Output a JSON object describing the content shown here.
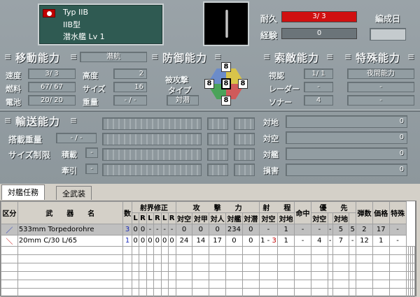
{
  "unit": {
    "type": "Typ IIB",
    "class": "IIB型",
    "name": "潜水艦 Lv 1",
    "flag_icon": "swastika-flag-icon"
  },
  "stats_top": {
    "durability_label": "耐久",
    "durability": "3/ 3",
    "durability_fill": 1.0,
    "exp_label": "経験",
    "exp": "0",
    "fleet_label": "編成日",
    "fleet_value": ""
  },
  "movement": {
    "title": "移動能力",
    "mode": "潜航",
    "speed_label": "速度",
    "speed": "3/ 3",
    "altitude_label": "高度",
    "altitude": "2",
    "fuel_label": "燃料",
    "fuel": "67/ 67",
    "size_label": "サイズ",
    "size": "16",
    "battery_label": "電池",
    "battery": "20/ 20",
    "weight_label": "重量",
    "weight": "- / -"
  },
  "defense": {
    "title": "防御能力",
    "attacked_label": "被攻撃",
    "type_label": "タイプ",
    "type_value": "対潜",
    "armor": {
      "top": "8",
      "left": "8",
      "center": "8",
      "right": "8",
      "bottom": "8"
    }
  },
  "search": {
    "title": "索敵能力",
    "vision_label": "視認",
    "vision": "1/ 1",
    "radar_label": "レーダー",
    "radar": "-",
    "sonar_label": "ソナー",
    "sonar": "4"
  },
  "special": {
    "title": "特殊能力",
    "items": [
      "夜間能力",
      "-",
      "-"
    ]
  },
  "transport": {
    "title": "輸送能力",
    "load_label": "搭載重量",
    "load": "- / -",
    "size_limit_label": "サイズ制限",
    "loaded_label": "積載",
    "loaded": "-",
    "tow_label": "牽引",
    "tow": "-"
  },
  "attack_summary": {
    "items": [
      {
        "label": "対地",
        "value": "0"
      },
      {
        "label": "対空",
        "value": "0"
      },
      {
        "label": "対艦",
        "value": "0"
      },
      {
        "label": "損害",
        "value": "0"
      }
    ]
  },
  "tabs": [
    "対艦任務",
    "全武装"
  ],
  "table": {
    "headers": {
      "kind": "区分",
      "weapon": "武　　器　　名",
      "count": "数",
      "range_fix": "射界修正",
      "attack": "攻　　撃　　力",
      "range": "射　　程",
      "hit": "命中",
      "priority": "優　　先",
      "ammo": "弾数",
      "price": "価格",
      "special": "特殊"
    },
    "sub_range_fix": [
      "L",
      "R",
      "L",
      "R",
      "L",
      "R"
    ],
    "sub_attack": [
      "対空",
      "対甲",
      "対人",
      "対艦",
      "対潜"
    ],
    "sub_range": [
      "対空",
      "対地"
    ],
    "sub_priority": [
      "対空",
      "対地"
    ],
    "rows": [
      {
        "icon": "torpedo-icon",
        "name": "533mm Torpedorohre",
        "count": "3",
        "fix": [
          "0",
          "0",
          "-",
          "-",
          "-",
          "-"
        ],
        "atk": [
          "0",
          "0",
          "0",
          "234",
          "0"
        ],
        "rng_air": "-",
        "rng_gnd": "1",
        "hit": "-",
        "pri": [
          "-",
          "-",
          "5",
          "5"
        ],
        "ammo": "2",
        "price": "17",
        "special": "-"
      },
      {
        "icon": "gun-icon",
        "name": "20mm C/30 L/65",
        "count": "1",
        "fix": [
          "0",
          "0",
          "0",
          "0",
          "0",
          "0"
        ],
        "atk": [
          "24",
          "14",
          "17",
          "0",
          "0"
        ],
        "rng_air": "1 - 3",
        "rng_gnd": "1",
        "hit": "-",
        "pri": [
          "4",
          "-",
          "7",
          "-"
        ],
        "ammo": "12",
        "price": "1",
        "special": "-"
      }
    ]
  }
}
